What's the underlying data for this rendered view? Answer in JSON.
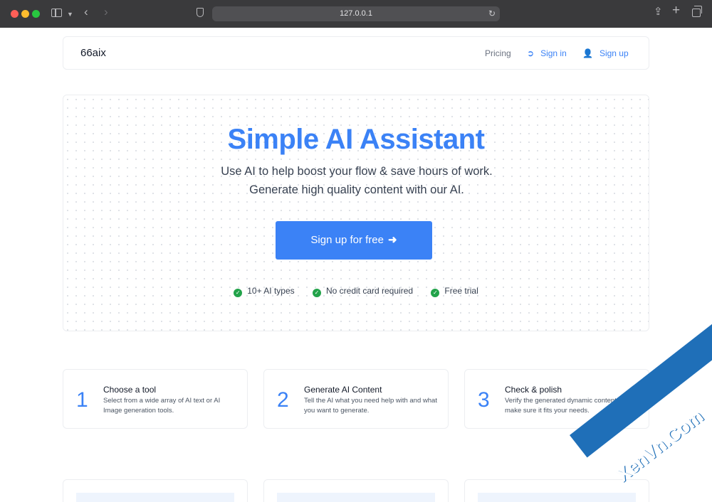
{
  "browser": {
    "url": "127.0.0.1"
  },
  "nav": {
    "brand": "66aix",
    "pricing": "Pricing",
    "sign_in": "Sign in",
    "sign_up": "Sign up"
  },
  "hero": {
    "title": "Simple AI Assistant",
    "subtitle": "Use AI to help boost your flow & save hours of work. Generate high quality content with our AI.",
    "cta": "Sign up for free",
    "features": [
      "10+ AI types",
      "No credit card required",
      "Free trial"
    ]
  },
  "steps": [
    {
      "number": "1",
      "title": "Choose a tool",
      "description": "Select from a wide array of AI text or AI Image generation tools."
    },
    {
      "number": "2",
      "title": "Generate AI Content",
      "description": "Tell the AI what you need help with and what you want to generate."
    },
    {
      "number": "3",
      "title": "Check & polish",
      "description": "Verify the generated dynamic content and make sure it fits your needs."
    }
  ],
  "watermark": "XenVn.Com",
  "colors": {
    "accent": "#3b82f6",
    "success": "#22a34a",
    "chrome": "#3a3a3c"
  },
  "icons": {
    "sign_in": "sign-in-icon",
    "sign_up": "user-plus-icon",
    "check": "check-circle-icon",
    "arrow": "arrow-right-icon"
  }
}
